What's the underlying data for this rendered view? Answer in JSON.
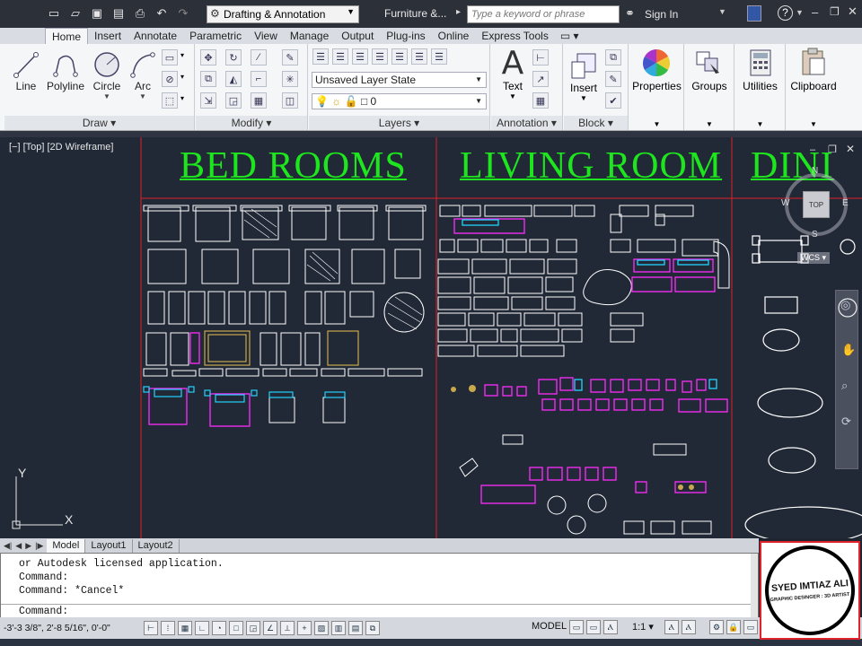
{
  "titlebar": {
    "workspace": "Drafting & Annotation",
    "file_title": "Furniture &...",
    "search_placeholder": "Type a keyword or phrase",
    "signin": "Sign In",
    "help": "?"
  },
  "tabs": [
    "Home",
    "Insert",
    "Annotate",
    "Parametric",
    "View",
    "Manage",
    "Output",
    "Plug-ins",
    "Online",
    "Express Tools"
  ],
  "active_tab": "Home",
  "ribbon": {
    "draw": {
      "title": "Draw",
      "tools": [
        "Line",
        "Polyline",
        "Circle",
        "Arc"
      ]
    },
    "modify": {
      "title": "Modify"
    },
    "layers": {
      "title": "Layers",
      "layer_state": "Unsaved Layer State",
      "current_layer": "0"
    },
    "annotation": {
      "title": "Annotation",
      "text": "Text"
    },
    "block": {
      "title": "Block",
      "insert": "Insert"
    },
    "properties": "Properties",
    "groups": "Groups",
    "utilities": "Utilities",
    "clipboard": "Clipboard"
  },
  "viewport": {
    "label": "[−] [Top] [2D Wireframe]",
    "headings": [
      "BED ROOMS",
      "LIVING ROOM",
      "DINI"
    ],
    "viewcube": {
      "top": "TOP",
      "n": "N",
      "s": "S",
      "e": "E",
      "w": "W",
      "wcs": "WCS"
    },
    "ucs": {
      "x": "X",
      "y": "Y"
    }
  },
  "layout_tabs": [
    "Model",
    "Layout1",
    "Layout2"
  ],
  "command": {
    "history": [
      "or Autodesk licensed application.",
      "Command:",
      "Command: *Cancel*"
    ],
    "prompt": "Command:"
  },
  "status": {
    "coords": "-3'-3 3/8\",  2'-8 5/16\", 0'-0\"",
    "model": "MODEL",
    "scale": "1:1"
  },
  "logo": {
    "name": "SYED IMTIAZ ALI",
    "subtitle": "GRAPHIC DESINGER : 3D ARTIST"
  },
  "colors": {
    "heading": "#1ee61e",
    "grid_line": "#e0222a",
    "furniture_white": "#ffffff",
    "furniture_magenta": "#ff2bff",
    "furniture_cyan": "#23d3ff",
    "furniture_gold": "#c8a84b"
  }
}
